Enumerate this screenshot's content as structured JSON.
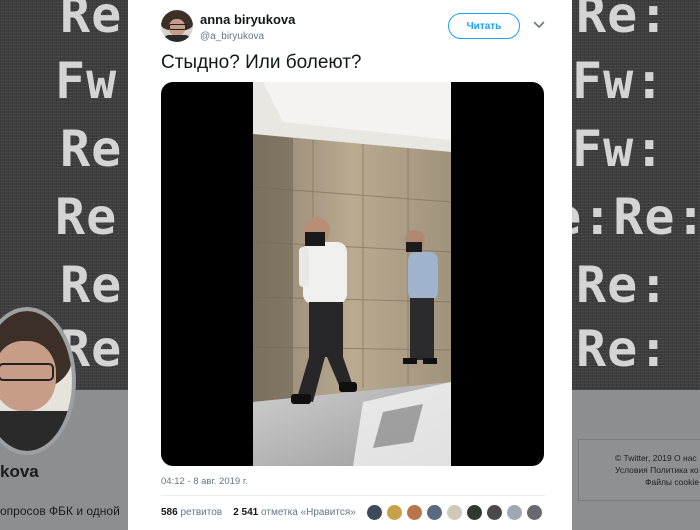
{
  "background": {
    "banner_lines": [
      "Re:",
      "Fw:",
      "Re:",
      "Re:",
      "Re:",
      "Re:"
    ],
    "banner_lines_right": [
      "Re:",
      "Fw:",
      "Fw:",
      "Re:Re:",
      "Re:",
      "Re:"
    ],
    "profile_name_partial": "kova",
    "profile_bio_partial": "опросов ФБК и одной",
    "footer": {
      "row1": "© Twitter, 2019   О нас",
      "row2": "Условия   Политика ко",
      "row3": "Файлы cookie"
    }
  },
  "tweet": {
    "author_name": "anna biryukova",
    "author_handle": "@a_biryukova",
    "follow_label": "Читать",
    "text": "Стыдно? Или болеют?",
    "timestamp": "04:12 - 8 авг. 2019 г.",
    "retweets_count": "586",
    "retweets_label": "ретвитов",
    "likes_count": "2 541",
    "likes_label": "отметка «Нравится»",
    "liker_avatar_colors": [
      "#3d4a5a",
      "#c9a04a",
      "#b8744a",
      "#5a6a80",
      "#d0c8b8",
      "#2f3a2f",
      "#4a4a4a",
      "#9ea8b2",
      "#666a70",
      "#c0c4c8"
    ]
  },
  "colors": {
    "accent": "#1da1f2",
    "text_primary": "#14171a",
    "text_secondary": "#657786"
  }
}
